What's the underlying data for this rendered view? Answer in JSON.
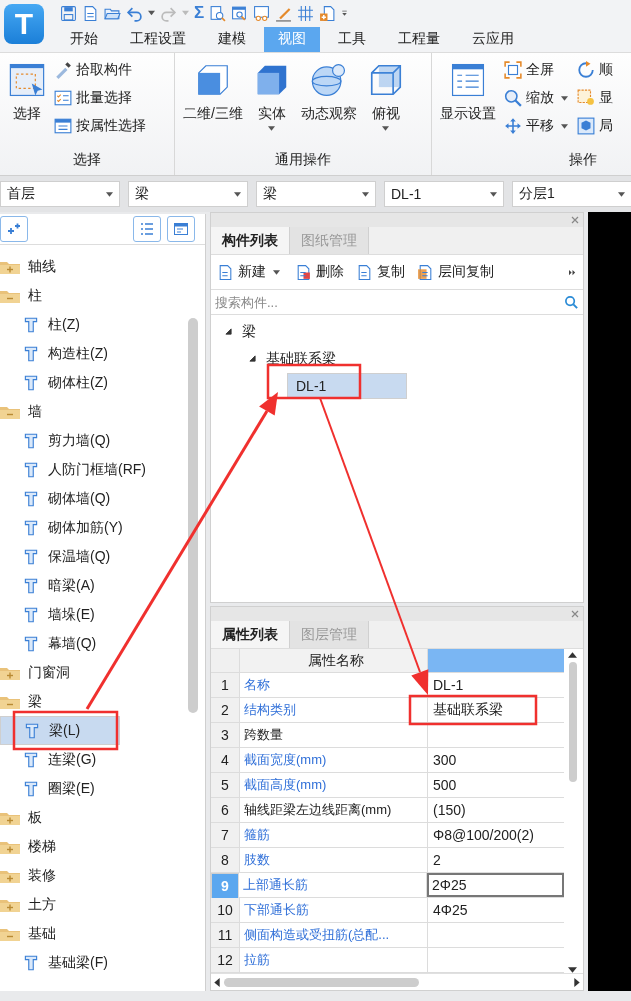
{
  "logo": {
    "letter": "T"
  },
  "quick_access": {
    "sum_symbol": "Σ"
  },
  "ribbon_tabs": [
    {
      "label": "开始",
      "selected": false
    },
    {
      "label": "工程设置",
      "selected": false
    },
    {
      "label": "建模",
      "selected": false
    },
    {
      "label": "视图",
      "selected": true
    },
    {
      "label": "工具",
      "selected": false
    },
    {
      "label": "工程量",
      "selected": false
    },
    {
      "label": "云应用",
      "selected": false
    }
  ],
  "ribbon_groups": [
    {
      "label": "选择",
      "buttons": [
        {
          "label": "选择",
          "kind": "large",
          "dropdown": false
        },
        {
          "label": "拾取构件",
          "kind": "small",
          "dropdown": false
        },
        {
          "label": "批量选择",
          "kind": "small",
          "dropdown": false
        },
        {
          "label": "按属性选择",
          "kind": "small",
          "dropdown": false
        }
      ]
    },
    {
      "label": "通用操作",
      "buttons": [
        {
          "label": "二维/三维",
          "kind": "large",
          "dropdown": false
        },
        {
          "label": "实体",
          "kind": "large",
          "dropdown": true
        },
        {
          "label": "动态观察",
          "kind": "large",
          "dropdown": false
        },
        {
          "label": "俯视",
          "kind": "large",
          "dropdown": true
        }
      ]
    },
    {
      "label": "操作",
      "buttons": [
        {
          "label": "显示设置",
          "kind": "large",
          "dropdown": false
        },
        {
          "label": "全屏",
          "kind": "small",
          "dropdown": false
        },
        {
          "label": "缩放",
          "kind": "small",
          "dropdown": true
        },
        {
          "label": "平移",
          "kind": "small",
          "dropdown": true
        },
        {
          "label": "顺",
          "kind": "small",
          "dropdown": false
        },
        {
          "label": "显",
          "kind": "small",
          "dropdown": false
        },
        {
          "label": "局",
          "kind": "small",
          "dropdown": false
        }
      ]
    }
  ],
  "selectors": [
    "首层",
    "梁",
    "梁",
    "DL-1",
    "分层1"
  ],
  "nav_tree": [
    {
      "label": "轴线",
      "expanded": false
    },
    {
      "label": "柱",
      "expanded": true,
      "children": [
        {
          "label": "柱(Z)",
          "selected": false
        },
        {
          "label": "构造柱(Z)",
          "selected": false
        },
        {
          "label": "砌体柱(Z)",
          "selected": false
        }
      ]
    },
    {
      "label": "墙",
      "expanded": true,
      "children": [
        {
          "label": "剪力墙(Q)",
          "selected": false
        },
        {
          "label": "人防门框墙(RF)",
          "selected": false
        },
        {
          "label": "砌体墙(Q)",
          "selected": false
        },
        {
          "label": "砌体加筋(Y)",
          "selected": false
        },
        {
          "label": "保温墙(Q)",
          "selected": false
        },
        {
          "label": "暗梁(A)",
          "selected": false
        },
        {
          "label": "墙垛(E)",
          "selected": false
        },
        {
          "label": "幕墙(Q)",
          "selected": false
        }
      ]
    },
    {
      "label": "门窗洞",
      "expanded": false
    },
    {
      "label": "梁",
      "expanded": true,
      "children": [
        {
          "label": "梁(L)",
          "selected": true
        },
        {
          "label": "连梁(G)",
          "selected": false
        },
        {
          "label": "圈梁(E)",
          "selected": false
        }
      ]
    },
    {
      "label": "板",
      "expanded": false
    },
    {
      "label": "楼梯",
      "expanded": false
    },
    {
      "label": "装修",
      "expanded": false
    },
    {
      "label": "土方",
      "expanded": false
    },
    {
      "label": "基础",
      "expanded": true,
      "children": [
        {
          "label": "基础梁(F)",
          "selected": false
        }
      ]
    }
  ],
  "component_panel": {
    "tabs": [
      {
        "label": "构件列表",
        "selected": true
      },
      {
        "label": "图纸管理",
        "selected": false
      }
    ],
    "toolbar": [
      {
        "label": "新建",
        "dropdown": true
      },
      {
        "label": "删除",
        "dropdown": false
      },
      {
        "label": "复制",
        "dropdown": false
      },
      {
        "label": "层间复制",
        "dropdown": false
      }
    ],
    "search": {
      "placeholder": "搜索构件..."
    },
    "tree": [
      {
        "label": "梁",
        "expanded": true,
        "children": [
          {
            "label": "基础联系梁",
            "expanded": true,
            "children": [
              {
                "label": "DL-1",
                "selected": true
              }
            ]
          }
        ]
      }
    ]
  },
  "property_panel": {
    "tabs": [
      {
        "label": "属性列表",
        "selected": true
      },
      {
        "label": "图层管理",
        "selected": false
      }
    ],
    "column_header": "属性名称",
    "rows": [
      {
        "index": "1",
        "name": "名称",
        "value": "DL-1",
        "public": true,
        "selected": false
      },
      {
        "index": "2",
        "name": "结构类别",
        "value": "基础联系梁",
        "public": true,
        "selected": false
      },
      {
        "index": "3",
        "name": "跨数量",
        "public": false,
        "selected": false
      },
      {
        "index": "4",
        "name": "截面宽度(mm)",
        "value": "300",
        "public": true,
        "selected": false
      },
      {
        "index": "5",
        "name": "截面高度(mm)",
        "value": "500",
        "public": true,
        "selected": false
      },
      {
        "index": "6",
        "name": "轴线距梁左边线距离(mm)",
        "value": "(150)",
        "public": false,
        "selected": false
      },
      {
        "index": "7",
        "name": "箍筋",
        "value": "Φ8@100/200(2)",
        "public": true,
        "selected": false
      },
      {
        "index": "8",
        "name": "肢数",
        "value": "2",
        "public": true,
        "selected": false
      },
      {
        "index": "9",
        "name": "上部通长筋",
        "value": "2Φ25",
        "public": true,
        "selected": true
      },
      {
        "index": "10",
        "name": "下部通长筋",
        "value": "4Φ25",
        "public": true,
        "selected": false
      },
      {
        "index": "11",
        "name": "侧面构造或受扭筋(总配...",
        "public": true,
        "selected": false
      },
      {
        "index": "12",
        "name": "拉筋",
        "public": true,
        "selected": false
      }
    ]
  }
}
